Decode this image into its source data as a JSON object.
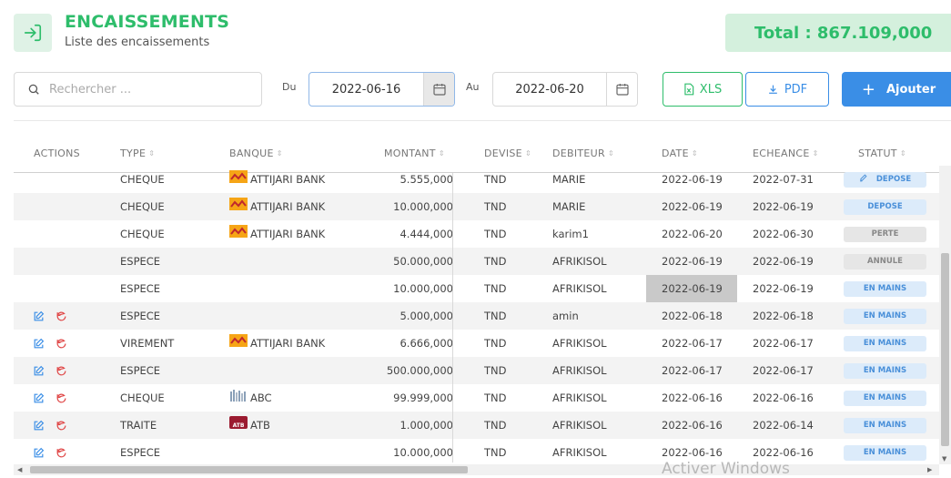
{
  "header": {
    "title": "ENCAISSEMENTS",
    "subtitle": "Liste des encaissements",
    "total": "Total : 867.109,000"
  },
  "search": {
    "placeholder": "Rechercher ..."
  },
  "filters": {
    "from_label": "Du",
    "from_value": "2022-06-16",
    "to_label": "Au",
    "to_value": "2022-06-20"
  },
  "buttons": {
    "xls": "XLS",
    "pdf": "PDF",
    "add": "Ajouter"
  },
  "table": {
    "headers": [
      "ACTIONS",
      "TYPE",
      "BANQUE",
      "MONTANT",
      "DEVISE",
      "DEBITEUR",
      "DATE",
      "ECHEANCE",
      "STATUT"
    ],
    "rows": [
      {
        "actions": false,
        "type": "CHEQUE",
        "bank": "ATTIJARI BANK",
        "bank_icon": "attijari-logo",
        "amount": "5.555,000",
        "currency": "TND",
        "debtor": "MARIE",
        "date": "2022-06-19",
        "due": "2022-07-31",
        "status": "DEPOSE",
        "status_icon": "pencil-icon",
        "status_color": "blue"
      },
      {
        "actions": false,
        "type": "CHEQUE",
        "bank": "ATTIJARI BANK",
        "bank_icon": "attijari-logo",
        "amount": "10.000,000",
        "currency": "TND",
        "debtor": "MARIE",
        "date": "2022-06-19",
        "due": "2022-06-19",
        "status": "DEPOSE",
        "status_color": "blue"
      },
      {
        "actions": false,
        "type": "CHEQUE",
        "bank": "ATTIJARI BANK",
        "bank_icon": "attijari-logo",
        "amount": "4.444,000",
        "currency": "TND",
        "debtor": "karim1",
        "date": "2022-06-20",
        "due": "2022-06-30",
        "status": "PERTE",
        "status_color": "grey"
      },
      {
        "actions": false,
        "type": "ESPECE",
        "bank": "",
        "amount": "50.000,000",
        "currency": "TND",
        "debtor": "AFRIKISOL",
        "date": "2022-06-19",
        "due": "2022-06-19",
        "status": "ANNULE",
        "status_color": "grey"
      },
      {
        "actions": false,
        "type": "ESPECE",
        "bank": "",
        "amount": "10.000,000",
        "currency": "TND",
        "debtor": "AFRIKISOL",
        "date": "2022-06-19",
        "date_highlight": true,
        "due": "2022-06-19",
        "status": "EN MAINS",
        "status_color": "blue"
      },
      {
        "actions": true,
        "type": "ESPECE",
        "bank": "",
        "amount": "5.000,000",
        "currency": "TND",
        "debtor": "amin",
        "date": "2022-06-18",
        "due": "2022-06-18",
        "status": "EN MAINS",
        "status_color": "blue"
      },
      {
        "actions": true,
        "type": "VIREMENT",
        "bank": "ATTIJARI BANK",
        "bank_icon": "attijari-logo",
        "amount": "6.666,000",
        "currency": "TND",
        "debtor": "AFRIKISOL",
        "date": "2022-06-17",
        "due": "2022-06-17",
        "status": "EN MAINS",
        "status_color": "blue"
      },
      {
        "actions": true,
        "type": "ESPECE",
        "bank": "",
        "amount": "500.000,000",
        "currency": "TND",
        "debtor": "AFRIKISOL",
        "date": "2022-06-17",
        "due": "2022-06-17",
        "status": "EN MAINS",
        "status_color": "blue"
      },
      {
        "actions": true,
        "type": "CHEQUE",
        "bank": "ABC",
        "bank_icon": "abc-logo",
        "amount": "99.999,000",
        "currency": "TND",
        "debtor": "AFRIKISOL",
        "date": "2022-06-16",
        "due": "2022-06-16",
        "status": "EN MAINS",
        "status_color": "blue"
      },
      {
        "actions": true,
        "type": "TRAITE",
        "bank": "ATB",
        "bank_icon": "atb-logo",
        "amount": "1.000,000",
        "currency": "TND",
        "debtor": "AFRIKISOL",
        "date": "2022-06-16",
        "due": "2022-06-14",
        "status": "EN MAINS",
        "status_color": "blue"
      },
      {
        "actions": true,
        "type": "ESPECE",
        "bank": "",
        "amount": "10.000,000",
        "currency": "TND",
        "debtor": "AFRIKISOL",
        "date": "2022-06-16",
        "due": "2022-06-16",
        "status": "EN MAINS",
        "status_color": "blue"
      }
    ]
  },
  "colors": {
    "green": "#2ebd6b",
    "blue": "#3a8ee6",
    "red": "#e04848"
  },
  "watermark": "Activer Windows"
}
